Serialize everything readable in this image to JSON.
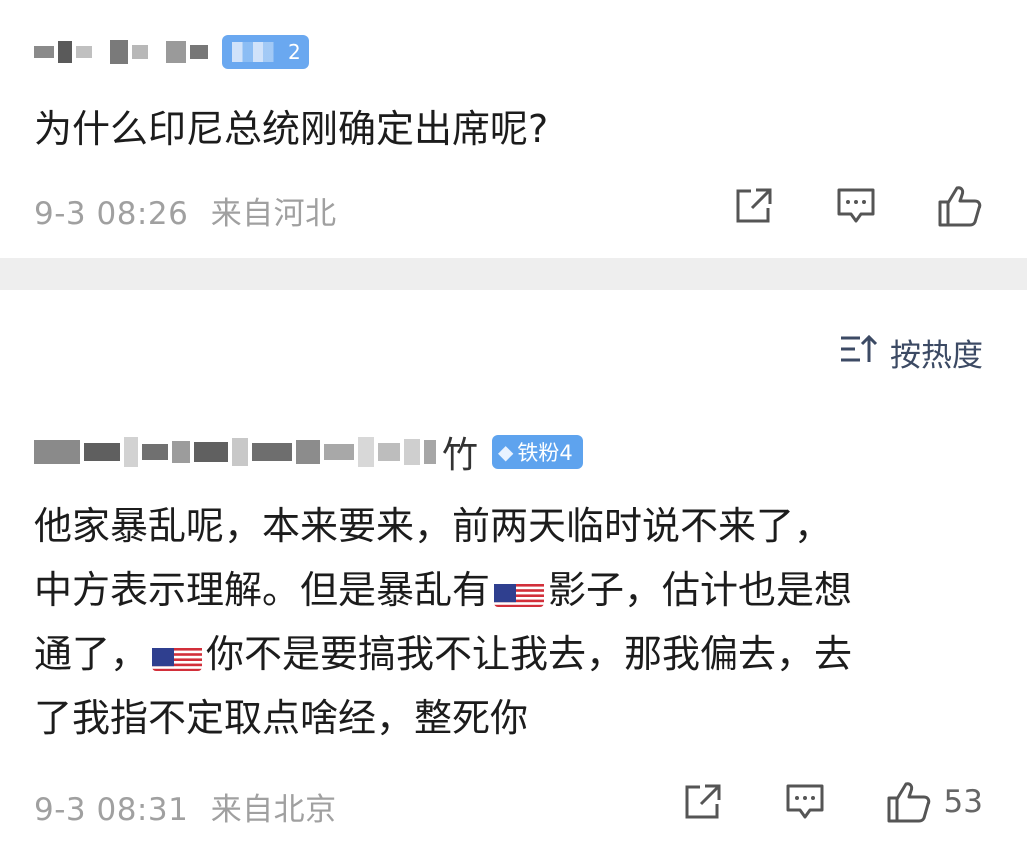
{
  "comments": [
    {
      "badge_level": "2",
      "text": "为什么印尼总统刚确定出席呢?",
      "time": "9-3 08:26",
      "location": "来自河北",
      "likes": ""
    },
    {
      "name_tail": "竹",
      "badge_label": "铁粉4",
      "text_parts": [
        "他家暴乱呢，本来要来，前两天临时说不来了，\n中方表示理解。但是暴乱有",
        "影子，估计也是想\n通了，",
        "你不是要搞我不让我去，那我偏去，去\n了我指不定取点啥经，整死你"
      ],
      "time": "9-3 08:31",
      "location": "来自北京",
      "likes": "53"
    }
  ],
  "sort": {
    "label": "按热度"
  },
  "icons": {
    "share": "share-icon",
    "comment": "comment-icon",
    "like": "like-icon",
    "sort": "sort-icon",
    "flag": "us-flag-icon"
  },
  "colors": {
    "badge_blue": "#6aa8f0",
    "meta_gray": "#a0a0a0",
    "separator": "#eeeeee"
  }
}
